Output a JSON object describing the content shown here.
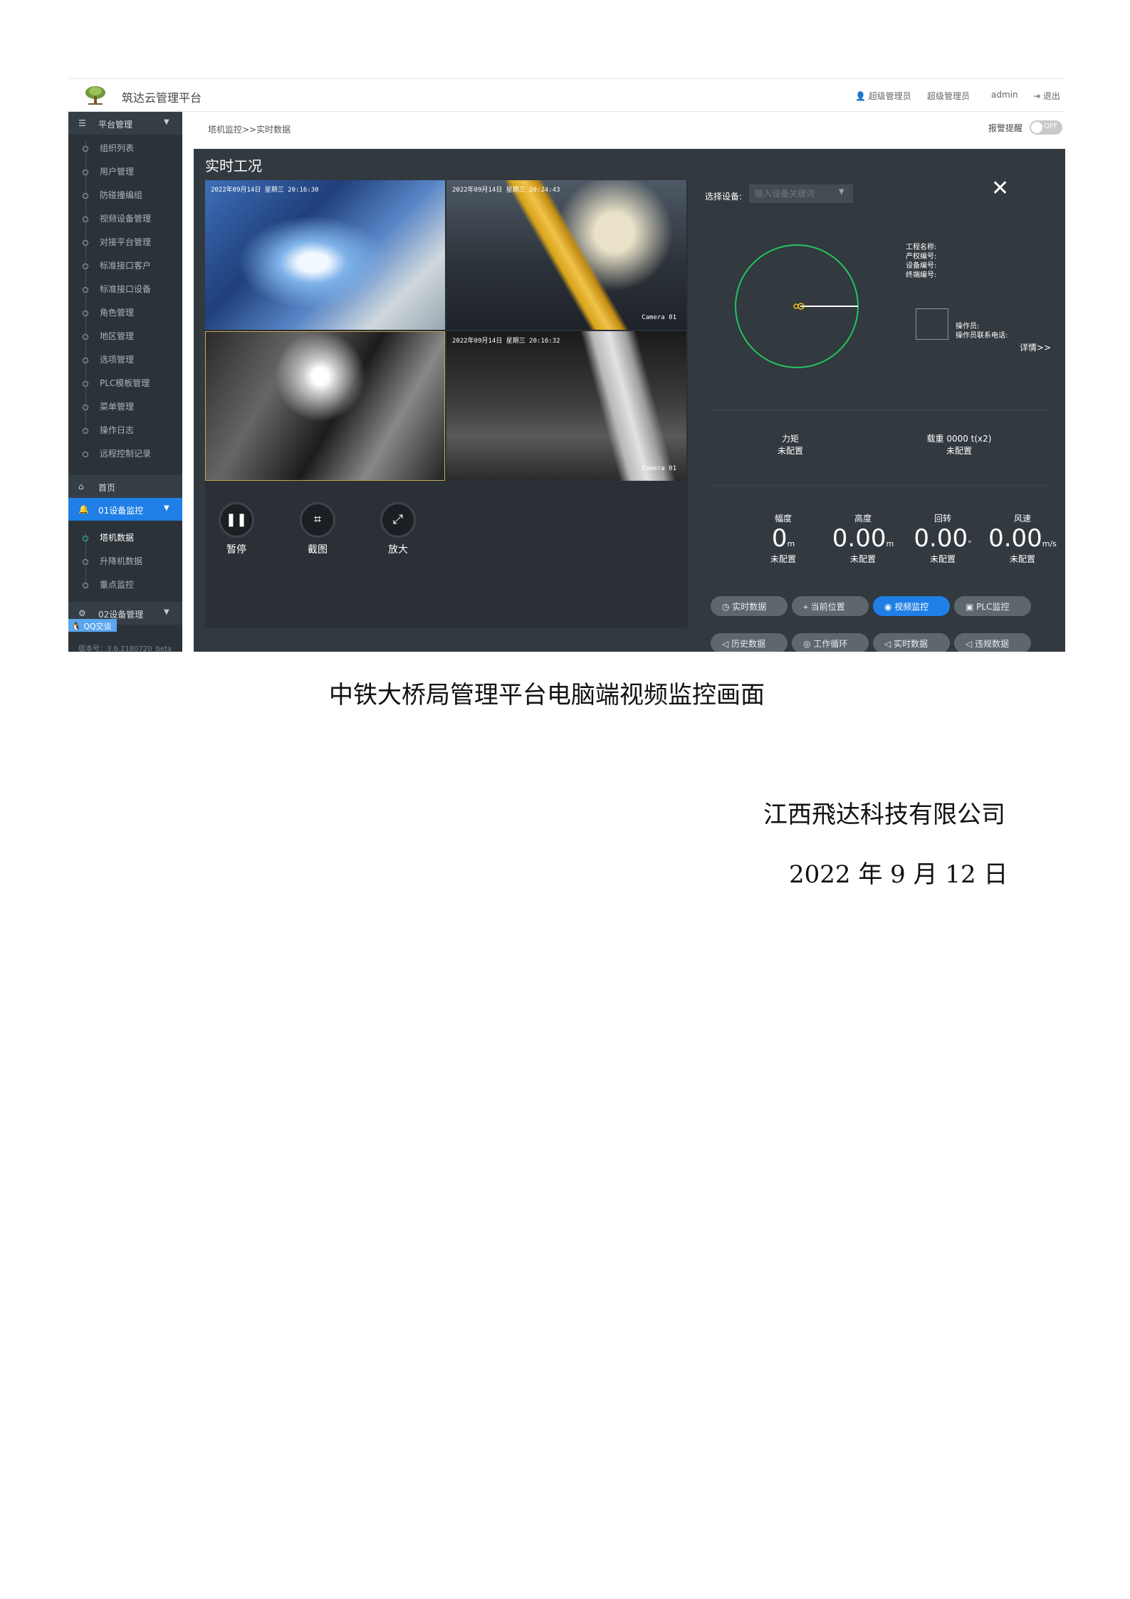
{
  "header": {
    "app_title": "筑达云管理平台",
    "user_role_1": "超级管理员",
    "user_role_2": "超级管理员",
    "username": "admin",
    "logout": "退出"
  },
  "sidebar": {
    "section_platform": "平台管理",
    "platform_items": [
      "组织列表",
      "用户管理",
      "防碰撞编组",
      "视频设备管理",
      "对接平台管理",
      "标准接口客户",
      "标准接口设备",
      "角色管理",
      "地区管理",
      "选项管理",
      "PLC模板管理",
      "菜单管理",
      "操作日志",
      "远程控制记录"
    ],
    "home": "首页",
    "section_monitor": "01设备监控",
    "monitor_items": [
      "塔机数据",
      "升降机数据",
      "重点监控"
    ],
    "section_device": "02设备管理",
    "qq_chat": "QQ交谈",
    "version": "版本号：3.6.2180720_beta"
  },
  "breadcrumb": "塔机监控>>实时数据",
  "alarm": {
    "label": "报警提醒",
    "state": "OFF"
  },
  "modal": {
    "title": "实时工况",
    "close_icon": "close-icon",
    "cameras": [
      {
        "timestamp": "2022年09月14日 星期三 20:16:30",
        "name": ""
      },
      {
        "timestamp": "2022年09月14日 星期三 20:24:43",
        "name": "Camera 01"
      },
      {
        "timestamp": "",
        "name": ""
      },
      {
        "timestamp": "2022年09月14日 星期三 20:16:32",
        "name": "Camera 01"
      }
    ],
    "controls": {
      "pause": "暂停",
      "snapshot": "截图",
      "zoom": "放大"
    },
    "device_select_label": "选择设备:",
    "device_select_placeholder": "输入设备关键词",
    "info": {
      "project_name": "工程名称:",
      "property_no": "产权编号:",
      "device_no": "设备编号:",
      "terminal_no": "终端编号:",
      "operator": "操作员:",
      "operator_phone": "操作员联系电话:",
      "detail_link": "详情>>"
    },
    "metrics": {
      "moment": {
        "name": "力矩",
        "status": "未配置"
      },
      "load": {
        "name": "载重 0000 t(x2)",
        "status": "未配置"
      }
    },
    "gauges": [
      {
        "name": "幅度",
        "value": "0",
        "unit": "m",
        "status": "未配置"
      },
      {
        "name": "高度",
        "value": "0.00",
        "unit": "m",
        "status": "未配置"
      },
      {
        "name": "回转",
        "value": "0.00",
        "unit": "°",
        "status": "未配置"
      },
      {
        "name": "风速",
        "value": "0.00",
        "unit": "m/s",
        "status": "未配置"
      }
    ],
    "tabs": [
      {
        "label": "实时数据",
        "icon": "clock-icon",
        "active": false
      },
      {
        "label": "当前位置",
        "icon": "location-icon",
        "active": false
      },
      {
        "label": "视频监控",
        "icon": "camera-icon",
        "active": true
      },
      {
        "label": "PLC监控",
        "icon": "plc-icon",
        "active": false
      },
      {
        "label": "历史数据",
        "icon": "speaker-icon",
        "active": false
      },
      {
        "label": "工作循环",
        "icon": "cycle-icon",
        "active": false
      },
      {
        "label": "实时数据",
        "icon": "speaker-icon",
        "active": false
      },
      {
        "label": "违规数据",
        "icon": "speaker-icon",
        "active": false
      }
    ]
  },
  "document": {
    "caption": "中铁大桥局管理平台电脑端视频监控画面",
    "company": "江西飛达科技有限公司",
    "date": "2022 年 9 月 12 日"
  },
  "colors": {
    "accent": "#1f7fe6",
    "sidebar": "#2b3338",
    "panel": "#32393f",
    "radar": "#22c55e"
  }
}
